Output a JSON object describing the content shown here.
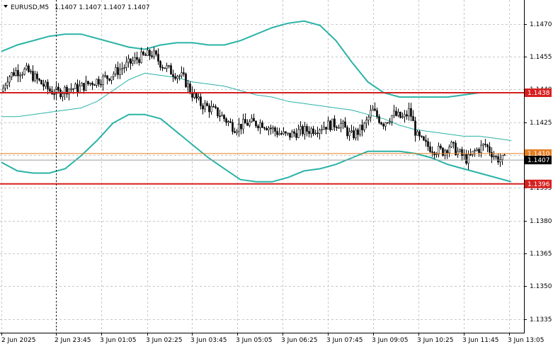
{
  "header": {
    "symbol_label": "EURUSD,M5",
    "ohlc_label": "1.1407 1.1407 1.1407 1.1407"
  },
  "colors": {
    "background": "#ffffff",
    "grid": "#c8c8c8",
    "candle": "#000000",
    "bands": "#2ab3a6",
    "level_line": "#d62020",
    "orange_line": "#e67e22",
    "price_line": "#9a9a9a"
  },
  "chart_data": {
    "type": "candlestick",
    "symbol": "EURUSD",
    "timeframe": "M5",
    "y_ticks": [
      "1.1470",
      "1.1455",
      "1.1440",
      "1.1425",
      "1.1410",
      "1.1395",
      "1.1380",
      "1.1365",
      "1.1350",
      "1.1335"
    ],
    "x_ticks": [
      "2 Jun 2025",
      "2 Jun 23:45",
      "3 Jun 01:05",
      "3 Jun 02:25",
      "3 Jun 03:45",
      "3 Jun 05:05",
      "3 Jun 06:25",
      "3 Jun 07:45",
      "3 Jun 09:05",
      "3 Jun 10:25",
      "3 Jun 11:45",
      "3 Jun 13:05"
    ],
    "ylim": [
      1.13275,
      1.14807
    ],
    "levels": [
      {
        "value": 1.1438,
        "label": "1.1438",
        "color": "#d62020"
      },
      {
        "value": 1.1396,
        "label": "1.1396",
        "color": "#d62020"
      },
      {
        "value": 1.141,
        "label": "1.1410",
        "color": "#e67e22"
      }
    ],
    "current_price": {
      "value": 1.1407,
      "label": "1.1407"
    },
    "vline_x_label": "2 Jun 23:45",
    "bands": {
      "upper": [
        1.1457,
        1.146,
        1.1462,
        1.1464,
        1.1465,
        1.1465,
        1.1463,
        1.1461,
        1.1459,
        1.1458,
        1.146,
        1.1461,
        1.1461,
        1.146,
        1.146,
        1.1462,
        1.1465,
        1.1468,
        1.147,
        1.1471,
        1.1469,
        1.1462,
        1.1452,
        1.1443,
        1.1438,
        1.1436,
        1.1436,
        1.1436,
        1.1436,
        1.1437,
        1.1438,
        1.1438,
        1.1438
      ],
      "middle": [
        1.1427,
        1.1427,
        1.1428,
        1.1429,
        1.143,
        1.1431,
        1.1434,
        1.1439,
        1.1444,
        1.1447,
        1.1446,
        1.1445,
        1.1443,
        1.1442,
        1.1441,
        1.1439,
        1.1437,
        1.1436,
        1.1434,
        1.1433,
        1.1432,
        1.1431,
        1.143,
        1.1428,
        1.1426,
        1.1423,
        1.1421,
        1.142,
        1.1419,
        1.1418,
        1.1418,
        1.1417,
        1.1416
      ],
      "lower": [
        1.1406,
        1.1402,
        1.1401,
        1.1401,
        1.1403,
        1.1409,
        1.1416,
        1.1424,
        1.1428,
        1.1428,
        1.1426,
        1.142,
        1.1414,
        1.1408,
        1.1403,
        1.1398,
        1.1397,
        1.1397,
        1.1399,
        1.1402,
        1.1403,
        1.1405,
        1.1408,
        1.1411,
        1.1411,
        1.1411,
        1.141,
        1.1408,
        1.1405,
        1.1403,
        1.1401,
        1.1399,
        1.1397
      ]
    }
  }
}
